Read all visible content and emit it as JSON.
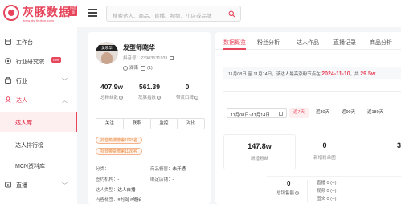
{
  "brand": {
    "name": "灰豚数据",
    "badge": "抖音版",
    "url": "www.dy.huitun.com"
  },
  "search": {
    "placeholder": "搜索达人、商品、直播、视频、小店或品牌"
  },
  "sidebar": {
    "items": [
      {
        "label": "工作台",
        "icon": "home-icon"
      },
      {
        "label": "行业研究院",
        "icon": "research-icon",
        "badge": "new"
      },
      {
        "label": "行业",
        "icon": "industry-icon",
        "chevron": "﹀"
      },
      {
        "label": "达人",
        "icon": "person-icon",
        "chevron": "︿"
      },
      {
        "label": "直播",
        "icon": "live-icon",
        "chevron": "﹀"
      }
    ],
    "sub_items": [
      {
        "label": "达人库"
      },
      {
        "label": "达人排行榜"
      },
      {
        "label": "MCN资料库"
      }
    ]
  },
  "profile": {
    "avatar_badge": "吴晓华",
    "name": "发型师晓华",
    "id_label": "抖音号：",
    "id_value": "23903531931",
    "location": "湖南",
    "extra_count": "(1)",
    "stats": [
      {
        "value": "407.9w",
        "label": "总粉丝数"
      },
      {
        "value": "561.39",
        "label": "灰豚指数"
      },
      {
        "value": "0",
        "label": "带货口碑"
      }
    ],
    "actions": [
      "关注",
      "联系",
      "监控",
      "对比"
    ],
    "tags": [
      "抖音热搜榜第1065名",
      "抖音带货榜第1126名"
    ],
    "info": {
      "category_label": "分类：",
      "category_value": "-",
      "window_label": "商品橱窗：",
      "window_value": "未开通",
      "org_label": "签约机构：",
      "org_value": "-",
      "store_label": "绑定店铺：",
      "store_value": "-",
      "type_label": "达人类型：",
      "type_value": "达人自播",
      "content_label": "内容标签：",
      "content_value": "#时尚 #随拍"
    }
  },
  "tabs": [
    "数据概览",
    "粉丝分析",
    "达人作品",
    "直播记录",
    "商品分析"
  ],
  "active_tab": 0,
  "banner": {
    "text": "11月08日 至 11月14日，该达人最高涨粉节点在",
    "date": "2024-11-10",
    "mid": "，共",
    "gain": "29.5w"
  },
  "date_range": {
    "value": "11月08日~11月14日",
    "options": [
      "近7天",
      "近30天",
      "近90天",
      "近180天"
    ],
    "selected": 0
  },
  "metrics": [
    {
      "value": "147.8w",
      "label": "新增粉丝"
    },
    {
      "value": "0",
      "label": "新增粉丝团"
    },
    {
      "value": "3",
      "label": ""
    }
  ],
  "sales": {
    "value": "0",
    "label": "总销售额",
    "rows": [
      {
        "label": "直播",
        "value": "0 (--)"
      },
      {
        "label": "视频",
        "value": "0 (--)"
      },
      {
        "label": "图文",
        "value": "0 (--)"
      }
    ]
  },
  "colors": {
    "accent": "#e6455b",
    "tag_orange": "#e8853b",
    "sidebar_active_bg": "#fdeef0"
  }
}
